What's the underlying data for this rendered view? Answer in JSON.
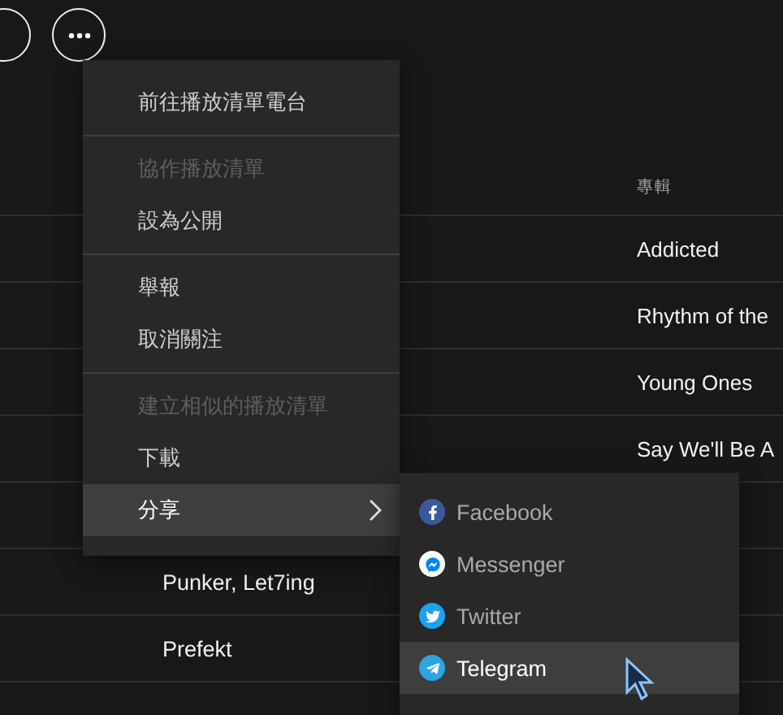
{
  "table": {
    "columns": [
      {
        "label": "專輯"
      }
    ],
    "rows": [
      {
        "album": "Addicted"
      },
      {
        "album": "Rhythm of the"
      },
      {
        "album": "Young Ones"
      },
      {
        "album": "Say We'll Be A"
      },
      {},
      {
        "artist": "Punker, Let7ing"
      },
      {
        "artist": "Prefekt"
      }
    ]
  },
  "context_menu": {
    "groups": [
      [
        {
          "label": "前往播放清單電台",
          "disabled": false,
          "selected": false,
          "submenu": false
        }
      ],
      [
        {
          "label": "協作播放清單",
          "disabled": true,
          "selected": false,
          "submenu": false
        },
        {
          "label": "設為公開",
          "disabled": false,
          "selected": false,
          "submenu": false
        }
      ],
      [
        {
          "label": "舉報",
          "disabled": false,
          "selected": false,
          "submenu": false
        },
        {
          "label": "取消關注",
          "disabled": false,
          "selected": false,
          "submenu": false
        }
      ],
      [
        {
          "label": "建立相似的播放清單",
          "disabled": true,
          "selected": false,
          "submenu": false
        },
        {
          "label": "下載",
          "disabled": false,
          "selected": false,
          "submenu": false
        },
        {
          "label": "分享",
          "disabled": false,
          "selected": true,
          "submenu": true
        }
      ]
    ]
  },
  "share_menu": {
    "items": [
      {
        "kind": "facebook",
        "label": "Facebook",
        "selected": false
      },
      {
        "kind": "messenger",
        "label": "Messenger",
        "selected": false
      },
      {
        "kind": "twitter",
        "label": "Twitter",
        "selected": false
      },
      {
        "kind": "telegram",
        "label": "Telegram",
        "selected": true
      }
    ]
  }
}
